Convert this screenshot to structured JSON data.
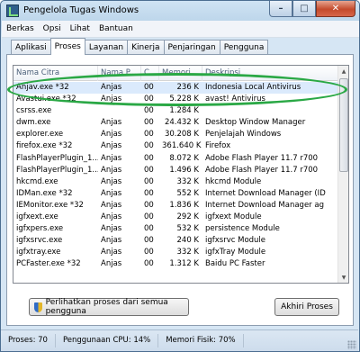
{
  "window": {
    "title": "Pengelola Tugas Windows"
  },
  "caption_buttons": {
    "minimize": "–",
    "maximize": "□",
    "close": "✕"
  },
  "menu": [
    "Berkas",
    "Opsi",
    "Lihat",
    "Bantuan"
  ],
  "tabs": [
    "Aplikasi",
    "Proses",
    "Layanan",
    "Kinerja",
    "Penjaringan",
    "Pengguna"
  ],
  "active_tab": "Proses",
  "table": {
    "headers": [
      "Nama Citra",
      "Nama P...",
      "C...",
      "Memori ...",
      "Deskripsi"
    ],
    "rows": [
      [
        "Anjav.exe *32",
        "Anjas",
        "00",
        "236 K",
        "Indonesia Local Antivirus"
      ],
      [
        "Avastui.exe *32",
        "Anjas",
        "00",
        "5.228 K",
        "avast! Antivirus"
      ],
      [
        "csrss.exe",
        "",
        "00",
        "1.284 K",
        ""
      ],
      [
        "dwm.exe",
        "Anjas",
        "00",
        "24.432 K",
        "Desktop Window Manager"
      ],
      [
        "explorer.exe",
        "Anjas",
        "00",
        "30.208 K",
        "Penjelajah Windows"
      ],
      [
        "firefox.exe *32",
        "Anjas",
        "00",
        "361.640 K",
        "Firefox"
      ],
      [
        "FlashPlayerPlugin_1...",
        "Anjas",
        "00",
        "8.072 K",
        "Adobe Flash Player 11.7 r700"
      ],
      [
        "FlashPlayerPlugin_1...",
        "Anjas",
        "00",
        "1.496 K",
        "Adobe Flash Player 11.7 r700"
      ],
      [
        "hkcmd.exe",
        "Anjas",
        "00",
        "332 K",
        "hkcmd Module"
      ],
      [
        "IDMan.exe *32",
        "Anjas",
        "00",
        "552 K",
        "Internet Download Manager (ID"
      ],
      [
        "IEMonitor.exe *32",
        "Anjas",
        "00",
        "1.836 K",
        "Internet Download Manager ag"
      ],
      [
        "igfxext.exe",
        "Anjas",
        "00",
        "292 K",
        "igfxext Module"
      ],
      [
        "igfxpers.exe",
        "Anjas",
        "00",
        "532 K",
        "persistence Module"
      ],
      [
        "igfxsrvc.exe",
        "Anjas",
        "00",
        "240 K",
        "igfxsrvc Module"
      ],
      [
        "igfxtray.exe",
        "Anjas",
        "00",
        "332 K",
        "igfxTray Module"
      ],
      [
        "PCFaster.exe *32",
        "Anjas",
        "00",
        "1.312 K",
        "Baidu PC Faster"
      ]
    ],
    "selected_row": 0
  },
  "buttons": {
    "show_all": "Perlihatkan proses dari semua pengguna",
    "end_process": "Akhiri Proses"
  },
  "status": {
    "processes": "Proses: 70",
    "cpu": "Penggunaan CPU: 14%",
    "memory": "Memori Fisik: 70%"
  },
  "colors": {
    "highlight_oval": "#2aa845",
    "selected_row": "#dbeafc"
  }
}
